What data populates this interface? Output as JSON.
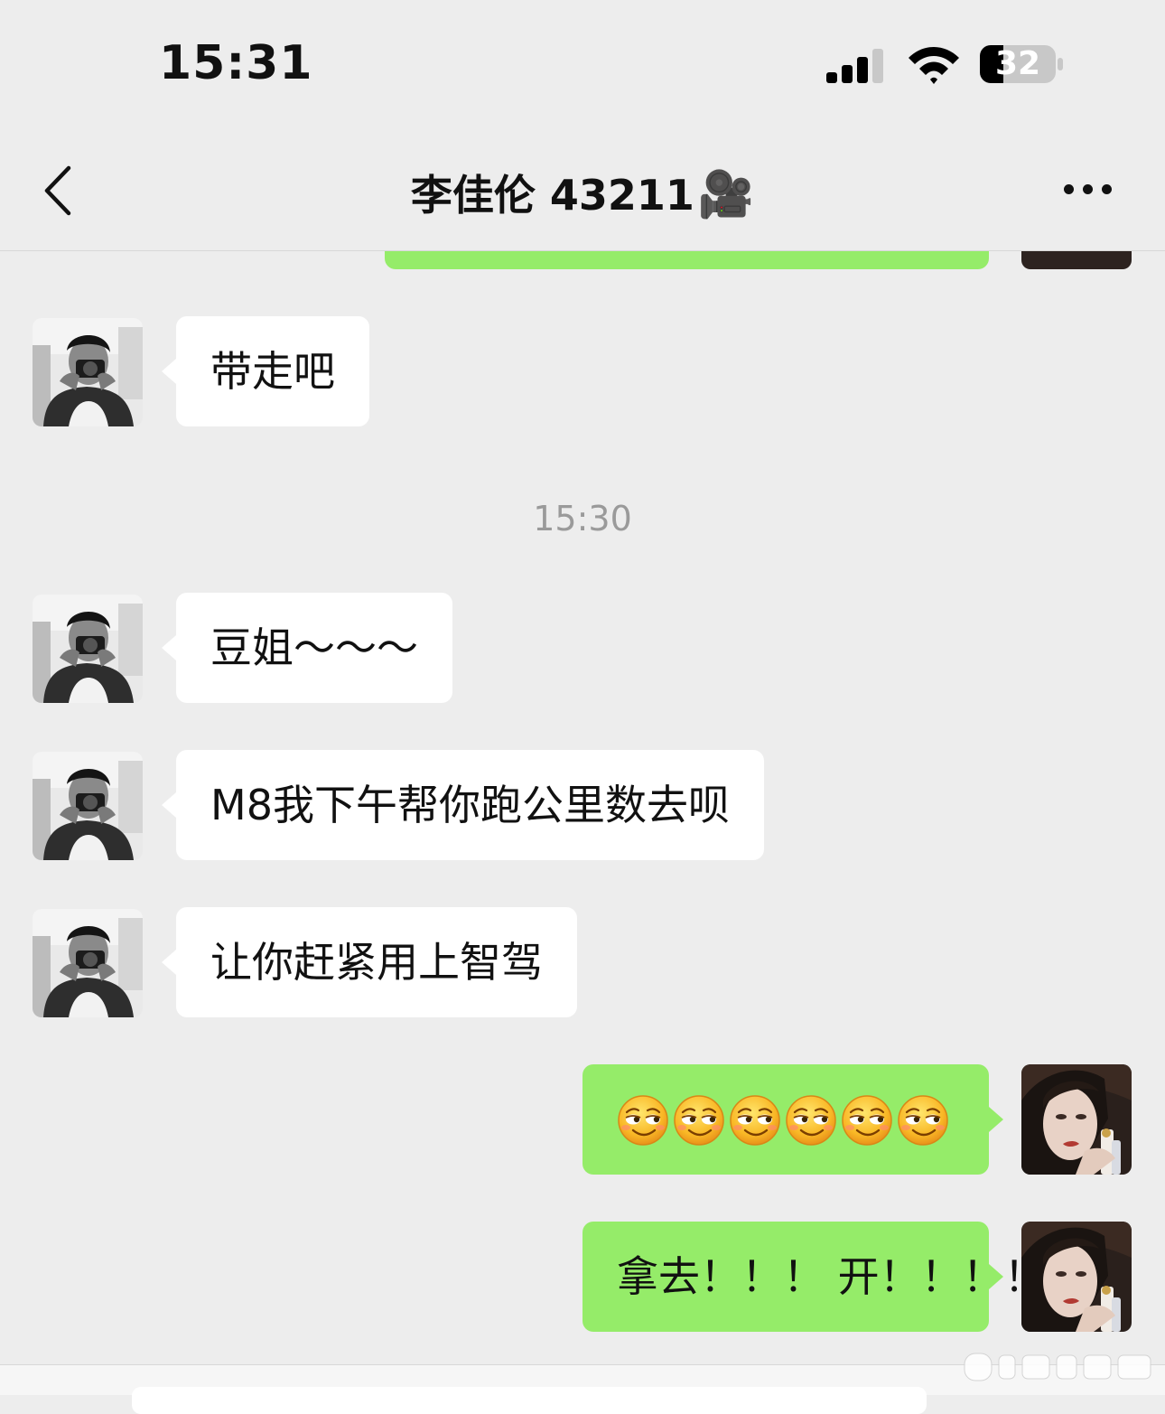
{
  "status_bar": {
    "time": "15:31",
    "battery": "32"
  },
  "header": {
    "title": "李佳伦 43211",
    "title_emoji": "🎥"
  },
  "messages": [
    {
      "side": "in",
      "text": "带走吧"
    },
    {
      "side": "in",
      "text": "豆姐～～～"
    },
    {
      "side": "in",
      "text": "M8我下午帮你跑公里数去呗"
    },
    {
      "side": "in",
      "text": "让你赶紧用上智驾"
    },
    {
      "side": "out",
      "emoji": "smirk",
      "emoji_count": 6
    },
    {
      "side": "out",
      "text": "拿去！！！ 开！！！！"
    }
  ],
  "timestamp": "15:30"
}
